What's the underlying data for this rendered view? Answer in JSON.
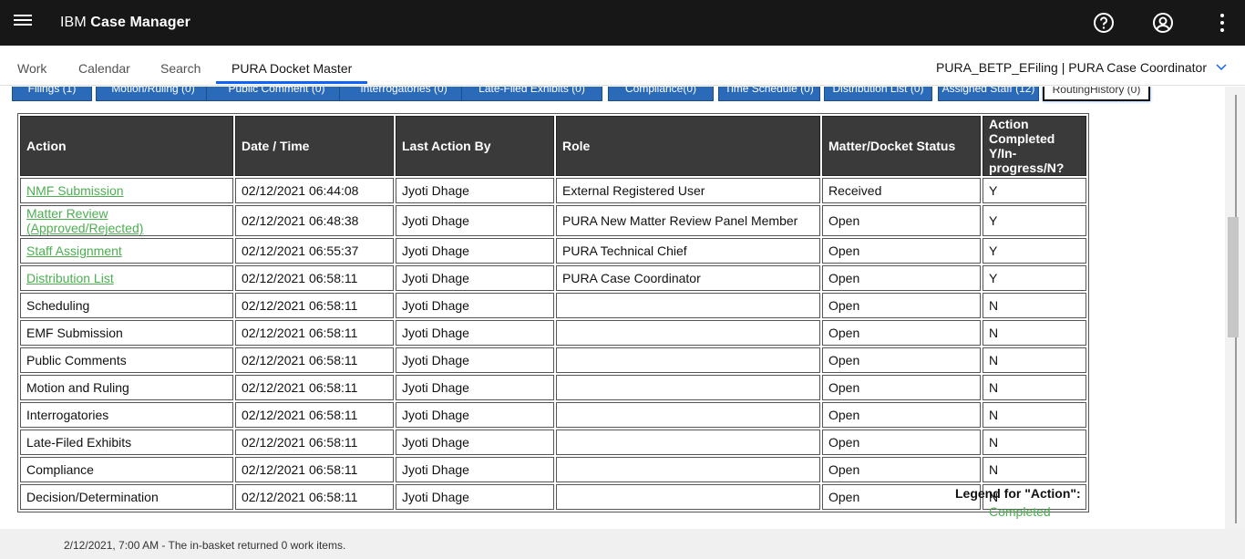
{
  "app": {
    "title_prefix": "IBM",
    "title_name": "Case Manager"
  },
  "tabs": [
    {
      "label": "Work"
    },
    {
      "label": "Calendar"
    },
    {
      "label": "Search"
    },
    {
      "label": "PURA Docket Master"
    }
  ],
  "role_selector": {
    "label": "PURA_BETP_EFiling | PURA Case Coordinator"
  },
  "inner_tabs": [
    {
      "label": "Filings (1)"
    },
    {
      "label": "Motion/Ruling (0)"
    },
    {
      "label": "Public Comment (0)"
    },
    {
      "label": "Interrogatories (0)"
    },
    {
      "label": "Late-Filed Exhibits (0)"
    },
    {
      "label": "Compliance(0)"
    },
    {
      "label": "Time Schedule (0)"
    },
    {
      "label": "Distribution List (0)"
    },
    {
      "label": "Assigned Staff (12)"
    },
    {
      "label": "RoutingHistory (0)"
    }
  ],
  "table": {
    "headers": {
      "action": "Action",
      "datetime": "Date / Time",
      "last_action_by": "Last Action By",
      "role": "Role",
      "status": "Matter/Docket Status",
      "completed_line1": "Action Completed",
      "completed_line2": "Y/In-progress/N?"
    },
    "rows": [
      {
        "action": "NMF Submission",
        "link": true,
        "datetime": "02/12/2021 06:44:08",
        "by": "Jyoti Dhage",
        "role": "External Registered User",
        "status": "Received",
        "completed": "Y"
      },
      {
        "action": "Matter Review (Approved/Rejected)",
        "link": true,
        "datetime": "02/12/2021 06:48:38",
        "by": "Jyoti Dhage",
        "role": "PURA New Matter Review Panel Member",
        "status": "Open",
        "completed": "Y"
      },
      {
        "action": "Staff Assignment",
        "link": true,
        "datetime": "02/12/2021 06:55:37",
        "by": "Jyoti Dhage",
        "role": "PURA Technical Chief",
        "status": "Open",
        "completed": "Y"
      },
      {
        "action": "Distribution List",
        "link": true,
        "datetime": "02/12/2021 06:58:11",
        "by": "Jyoti Dhage",
        "role": "PURA Case Coordinator",
        "status": "Open",
        "completed": "Y"
      },
      {
        "action": "Scheduling",
        "link": false,
        "datetime": "02/12/2021 06:58:11",
        "by": "Jyoti Dhage",
        "role": "",
        "status": "Open",
        "completed": "N"
      },
      {
        "action": "EMF Submission",
        "link": false,
        "datetime": "02/12/2021 06:58:11",
        "by": "Jyoti Dhage",
        "role": "",
        "status": "Open",
        "completed": "N"
      },
      {
        "action": "Public Comments",
        "link": false,
        "datetime": "02/12/2021 06:58:11",
        "by": "Jyoti Dhage",
        "role": "",
        "status": "Open",
        "completed": "N"
      },
      {
        "action": "Motion and Ruling",
        "link": false,
        "datetime": "02/12/2021 06:58:11",
        "by": "Jyoti Dhage",
        "role": "",
        "status": "Open",
        "completed": "N"
      },
      {
        "action": "Interrogatories",
        "link": false,
        "datetime": "02/12/2021 06:58:11",
        "by": "Jyoti Dhage",
        "role": "",
        "status": "Open",
        "completed": "N"
      },
      {
        "action": "Late-Filed Exhibits",
        "link": false,
        "datetime": "02/12/2021 06:58:11",
        "by": "Jyoti Dhage",
        "role": "",
        "status": "Open",
        "completed": "N"
      },
      {
        "action": "Compliance",
        "link": false,
        "datetime": "02/12/2021 06:58:11",
        "by": "Jyoti Dhage",
        "role": "",
        "status": "Open",
        "completed": "N"
      },
      {
        "action": "Decision/Determination",
        "link": false,
        "datetime": "02/12/2021 06:58:11",
        "by": "Jyoti Dhage",
        "role": "",
        "status": "Open",
        "completed": "N"
      }
    ]
  },
  "legend": {
    "title": "Legend for \"Action\":",
    "completed": "Completed"
  },
  "colors": {
    "topbar": "#171717",
    "accent": "#0f62fe",
    "completed_green": "#4caf50",
    "tab_blue": "#2a6ab8"
  },
  "statusbar": {
    "message": "2/12/2021, 7:00 AM - The in-basket returned 0 work items."
  }
}
